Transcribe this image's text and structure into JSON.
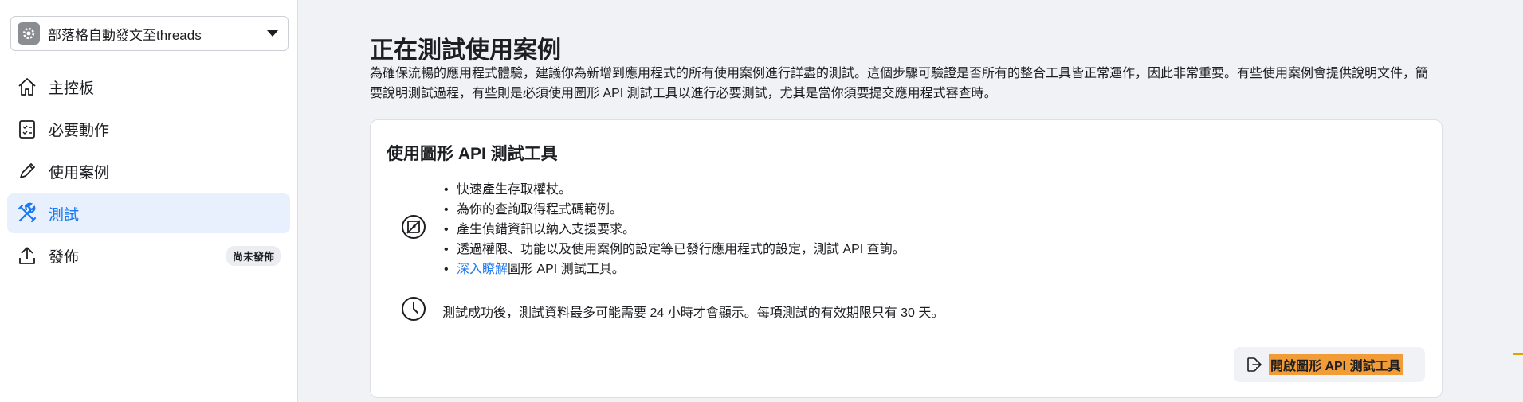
{
  "app_selector": {
    "name": "部落格自動發文至threads",
    "icon": "gear-icon"
  },
  "nav": [
    {
      "label": "主控板",
      "icon": "home-icon",
      "active": false
    },
    {
      "label": "必要動作",
      "icon": "checklist-icon",
      "active": false
    },
    {
      "label": "使用案例",
      "icon": "pencil-icon",
      "active": false
    },
    {
      "label": "測試",
      "icon": "tools-icon",
      "active": true
    },
    {
      "label": "發佈",
      "icon": "upload-icon",
      "active": false,
      "badge": "尚未發佈"
    }
  ],
  "main": {
    "title": "正在測試使用案例",
    "description": "為確保流暢的應用程式體驗，建議你為新增到應用程式的所有使用案例進行詳盡的測試。這個步驟可驗證是否所有的整合工具皆正常運作，因此非常重要。有些使用案例會提供說明文件，簡要說明測試過程，有些則是必須使用圖形 API 測試工具以進行必要測試，尤其是當你須要提交應用程式審查時。"
  },
  "card": {
    "title": "使用圖形 API 測試工具",
    "features": [
      "快速產生存取權杖。",
      "為你的查詢取得程式碼範例。",
      "產生偵錯資訊以納入支援要求。",
      "透過權限、功能以及使用案例的設定等已發行應用程式的設定，測試 API 查詢。"
    ],
    "learn_more_link": "深入瞭解",
    "learn_more_suffix": "圖形 API 測試工具。",
    "note": "測試成功後，測試資料最多可能需要 24 小時才會顯示。每項測試的有效期限只有 30 天。",
    "open_button": "開啟圖形 API 測試工具"
  },
  "colors": {
    "accent": "#1877f2",
    "active_bg": "#e7f0fc",
    "highlight": "#f29c38"
  }
}
